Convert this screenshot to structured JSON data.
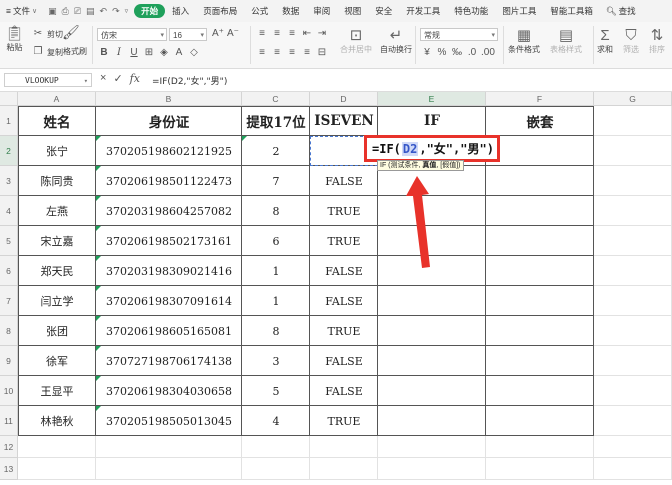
{
  "menubar": {
    "file": "文件",
    "tabs": [
      "开始",
      "插入",
      "页面布局",
      "公式",
      "数据",
      "审阅",
      "视图",
      "安全",
      "开发工具",
      "特色功能",
      "图片工具",
      "智能工具箱"
    ],
    "active_tab": "开始",
    "search": "查找"
  },
  "ribbon": {
    "paste": "粘贴",
    "cut": "剪切",
    "copy": "复制",
    "format_painter": "格式刷",
    "font_name": "仿宋",
    "font_size": "16",
    "merge": "合并居中",
    "wrap": "自动换行",
    "number_format": "常规",
    "conditional_format": "条件格式",
    "table_style": "表格样式",
    "sum": "求和",
    "filter": "筛选",
    "sort": "排序"
  },
  "formula_bar": {
    "name_box": "VLOOKUP",
    "cancel_icon": "×",
    "confirm_icon": "✓",
    "fx": "fx",
    "formula": "=IF(D2,\"女\",\"男\")"
  },
  "grid": {
    "columns": [
      "A",
      "B",
      "C",
      "D",
      "E",
      "F",
      "G"
    ],
    "selected_column": "E",
    "row_numbers": [
      "1",
      "2",
      "3",
      "4",
      "5",
      "6",
      "7",
      "8",
      "9",
      "10",
      "11",
      "12",
      "13"
    ],
    "selected_row": "2",
    "headers": [
      "姓名",
      "身份证",
      "提取17位",
      "ISEVEN",
      "IF",
      "嵌套"
    ],
    "rows": [
      {
        "name": "张宁",
        "id": "370205198602121925",
        "digit": "2",
        "iseven": ""
      },
      {
        "name": "陈同贵",
        "id": "370206198501122473",
        "digit": "7",
        "iseven": "FALSE"
      },
      {
        "name": "左燕",
        "id": "370203198604257082",
        "digit": "8",
        "iseven": "TRUE"
      },
      {
        "name": "宋立嘉",
        "id": "370206198502173161",
        "digit": "6",
        "iseven": "TRUE"
      },
      {
        "name": "郑天民",
        "id": "370203198309021416",
        "digit": "1",
        "iseven": "FALSE"
      },
      {
        "name": "闫立学",
        "id": "370206198307091614",
        "digit": "1",
        "iseven": "FALSE"
      },
      {
        "name": "张团",
        "id": "370206198605165081",
        "digit": "8",
        "iseven": "TRUE"
      },
      {
        "name": "徐军",
        "id": "370727198706174138",
        "digit": "3",
        "iseven": "FALSE"
      },
      {
        "name": "王显平",
        "id": "370206198304030658",
        "digit": "5",
        "iseven": "FALSE"
      },
      {
        "name": "林艳秋",
        "id": "370205198505013045",
        "digit": "4",
        "iseven": "TRUE"
      }
    ],
    "edit": {
      "prefix": "=IF(",
      "ref": "D2",
      "suffix": ",\"女\",\"男\")"
    },
    "tooltip": {
      "func": "IF (测试条件, ",
      "bold": "真值",
      "rest": ", [假值])"
    }
  },
  "colors": {
    "accent": "#1fa05b",
    "highlight_border": "#e8322a",
    "arrow": "#e8322a",
    "ref_bg": "#cfd9f7"
  }
}
